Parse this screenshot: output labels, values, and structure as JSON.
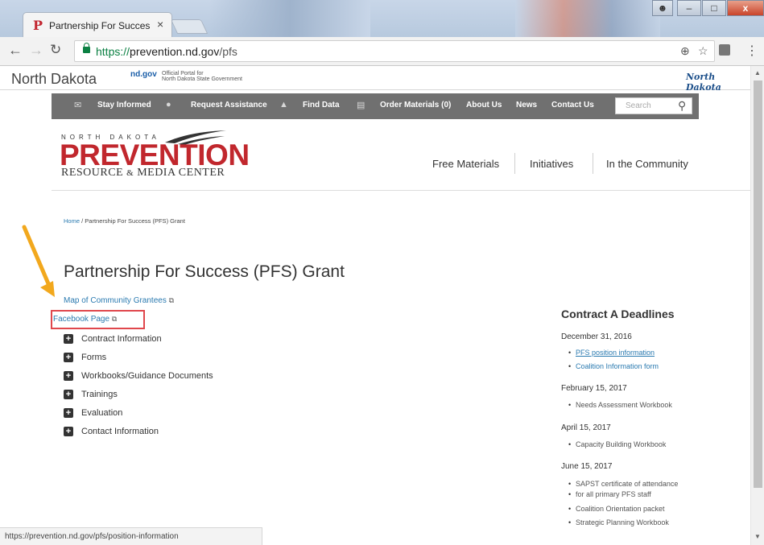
{
  "browser": {
    "tab_title": "Partnership For Success (",
    "tab_close": "×",
    "favicon": "P",
    "url_scheme": "https://",
    "url_host": "prevention.nd.gov",
    "url_path": "/pfs",
    "window_controls": {
      "minimize": "–",
      "maximize": "□",
      "close": "x"
    },
    "status_url": "https://prevention.nd.gov/pfs/position-information"
  },
  "nd_bar": {
    "title": "North Dakota",
    "gov": "nd.gov",
    "portal_line1": "Official Portal for",
    "portal_line2": "North Dakota State Government",
    "logo": "North Dakota"
  },
  "main_nav": {
    "items": [
      {
        "label": "Stay Informed",
        "icon": "mail-icon"
      },
      {
        "label": "Request Assistance",
        "icon": "chat-icon"
      },
      {
        "label": "Find Data",
        "icon": "chart-icon"
      },
      {
        "label": "Order Materials (0)",
        "icon": "cart-icon"
      },
      {
        "label": "About Us"
      },
      {
        "label": "News"
      },
      {
        "label": "Contact Us"
      }
    ],
    "search_placeholder": "Search"
  },
  "logo": {
    "top": "NORTH DAKOTA",
    "main": "PREVENTION",
    "resource": "RESOURCE",
    "amp": "&",
    "media": "MEDIA CENTER"
  },
  "secondary_nav": [
    "Free Materials",
    "Initiatives",
    "In the Community"
  ],
  "breadcrumb": {
    "home": "Home",
    "sep": " / ",
    "current": "Partnership For Success (PFS) Grant"
  },
  "page_title": "Partnership For Success (PFS) Grant",
  "links": {
    "map": "Map of Community Grantees",
    "facebook": "Facebook Page",
    "ext_glyph": "⧉"
  },
  "accordion": [
    "Contract Information",
    "Forms",
    "Workbooks/Guidance Documents",
    "Trainings",
    "Evaluation",
    "Contact Information"
  ],
  "deadlines": {
    "title": "Contract A Deadlines",
    "groups": [
      {
        "date": "December 31, 2016",
        "items": [
          "PFS position information",
          "Coalition Information form"
        ]
      },
      {
        "date": "February 15, 2017",
        "items": [
          "Needs Assessment Workbook"
        ]
      },
      {
        "date": "April 15, 2017",
        "items": [
          "Capacity Building Workbook"
        ]
      },
      {
        "date": "June 15, 2017",
        "items": [
          "SAPST certificate of attendance",
          "for all primary PFS staff",
          "Coalition Orientation packet",
          "Strategic Planning Workbook"
        ]
      }
    ]
  },
  "colors": {
    "brand_red": "#c1272d",
    "link_blue": "#2a7ab0",
    "nav_gray": "#707070",
    "highlight_red": "#e0474c",
    "arrow_orange": "#f2a81d"
  }
}
